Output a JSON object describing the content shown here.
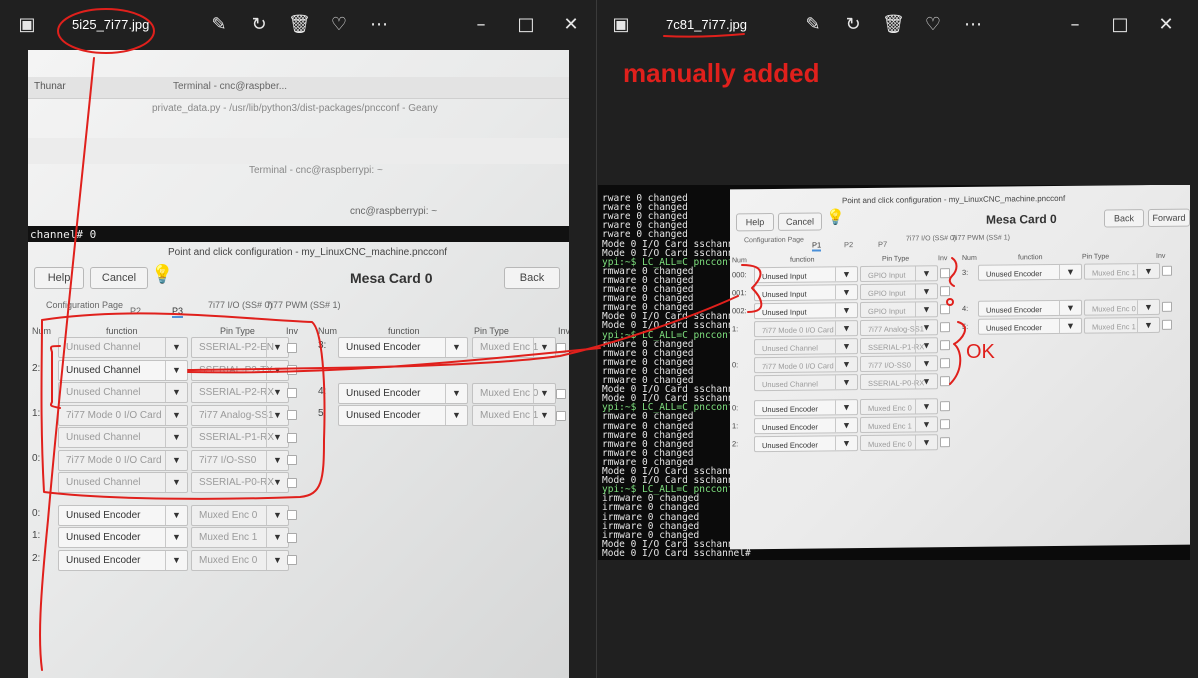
{
  "left_window": {
    "filename": "5i25_7i77.jpg",
    "icons": [
      "image-icon",
      "edit-icon",
      "rotate-icon",
      "delete-icon",
      "heart-icon",
      "more-icon",
      "minimize-icon",
      "maximize-icon",
      "close-icon"
    ],
    "photo": {
      "taskbar_thunar": "Thunar",
      "taskbar_terminal": "Terminal - cnc@raspber...",
      "geany_title": "private_data.py - /usr/lib/python3/dist-packages/pncconf - Geany",
      "terminal_title": "Terminal - cnc@raspberrypi: ~",
      "terminal_tab": "cnc@raspberrypi: ~",
      "terminal_line": "channel# 0",
      "dialog_title": "Point and click configuration - my_LinuxCNC_machine.pncconf",
      "help_btn": "Help",
      "cancel_btn": "Cancel",
      "back_btn": "Back",
      "heading": "Mesa Card 0",
      "tabs": [
        "Configuration Page",
        "P2",
        "P3",
        "7i77 I/O (SS# 0)",
        "7i77 PWM (SS# 1)"
      ],
      "col_headers": {
        "num": "Num",
        "function": "function",
        "pin_type": "Pin Type",
        "inv": "Inv",
        "num2": "Num",
        "function2": "function",
        "pin_type2": "Pin Type",
        "inv2": "Inv"
      },
      "rows_left": [
        {
          "num": "",
          "function": "Unused Channel",
          "pin": "SSERIAL-P2-EN",
          "dim": true
        },
        {
          "num": "2:",
          "function": "Unused Channel",
          "pin": "SSERIAL-P2-TX",
          "dim": false
        },
        {
          "num": "",
          "function": "Unused Channel",
          "pin": "SSERIAL-P2-RX",
          "dim": true
        },
        {
          "num": "1:",
          "function": "7i77 Mode 0 I/O Card",
          "pin": "7i77 Analog-SS1",
          "dim": true
        },
        {
          "num": "",
          "function": "Unused Channel",
          "pin": "SSERIAL-P1-RX",
          "dim": true
        },
        {
          "num": "0:",
          "function": "7i77 Mode 0 I/O Card",
          "pin": "7i77 I/O-SS0",
          "dim": true
        },
        {
          "num": "",
          "function": "Unused Channel",
          "pin": "SSERIAL-P0-RX",
          "dim": true
        },
        {
          "num": "0:",
          "function": "Unused Encoder",
          "pin": "Muxed Enc 0",
          "dim": false
        },
        {
          "num": "1:",
          "function": "Unused Encoder",
          "pin": "Muxed Enc 1",
          "dim": false
        },
        {
          "num": "2:",
          "function": "Unused Encoder",
          "pin": "Muxed Enc 0",
          "dim": false
        }
      ],
      "rows_right": [
        {
          "num": "3:",
          "function": "Unused Encoder",
          "pin": "Muxed Enc 1"
        },
        {
          "num": "4:",
          "function": "Unused Encoder",
          "pin": "Muxed Enc 0"
        },
        {
          "num": "5:",
          "function": "Unused Encoder",
          "pin": "Muxed Enc 1"
        }
      ]
    }
  },
  "right_window": {
    "filename": "7c81_7i77.jpg",
    "annotation_manual": "manually added",
    "annotation_ok": "OK",
    "photo": {
      "dialog_title": "Point and click configuration - my_LinuxCNC_machine.pncconf",
      "help_btn": "Help",
      "cancel_btn": "Cancel",
      "back_btn": "Back",
      "forward_btn": "Forward",
      "heading": "Mesa Card 0",
      "tabs": [
        "Configuration Page",
        "P1",
        "P2",
        "P7",
        "7i77 I/O (SS# 0)",
        "7i77 PWM (SS# 1)"
      ],
      "col_headers": {
        "num": "Num",
        "function": "function",
        "pin_type": "Pin Type",
        "inv": "Inv",
        "num2": "Num",
        "function2": "function",
        "pin_type2": "Pin Type",
        "inv2": "Inv"
      },
      "rows_left": [
        {
          "num": "000:",
          "function": "Unused Input",
          "pin": "GPIO Input",
          "dim": false
        },
        {
          "num": "001:",
          "function": "Unused Input",
          "pin": "GPIO Input",
          "dim": false
        },
        {
          "num": "002:",
          "function": "Unused Input",
          "pin": "GPIO Input",
          "dim": false
        },
        {
          "num": "1:",
          "function": "7i77 Mode 0 I/O Card",
          "pin": "7i77 Analog-SS1",
          "dim": true
        },
        {
          "num": "",
          "function": "Unused Channel",
          "pin": "SSERIAL-P1-RX",
          "dim": true
        },
        {
          "num": "0:",
          "function": "7i77 Mode 0 I/O Card",
          "pin": "7i77 I/O-SS0",
          "dim": true
        },
        {
          "num": "",
          "function": "Unused Channel",
          "pin": "SSERIAL-P0-RX",
          "dim": true
        },
        {
          "num": "0:",
          "function": "Unused Encoder",
          "pin": "Muxed Enc 0",
          "dim": false
        },
        {
          "num": "1:",
          "function": "Unused Encoder",
          "pin": "Muxed Enc 1",
          "dim": false
        },
        {
          "num": "2:",
          "function": "Unused Encoder",
          "pin": "Muxed Enc 0",
          "dim": false
        }
      ],
      "rows_right": [
        {
          "num": "3:",
          "function": "Unused Encoder",
          "pin": "Muxed Enc 1"
        },
        {
          "num": "4:",
          "function": "Unused Encoder",
          "pin": "Muxed Enc 0"
        },
        {
          "num": "5:",
          "function": "Unused Encoder",
          "pin": "Muxed Enc 1"
        }
      ],
      "terminal_lines": [
        "rware 0 changed",
        "rware 0 changed",
        "rware 0 changed",
        "rware 0 changed",
        "rware 0 changed",
        "Mode 0 I/O Card sschannel#",
        "Mode 0 I/O Card sschannel#",
        "ypi:~$ LC_ALL=C pncconf",
        "rmware 0 changed",
        "rmware 0 changed",
        "rmware 0 changed",
        "rmware 0 changed",
        "rmware 0 changed",
        "Mode 0 I/O Card sschannel#",
        "Mode 0 I/O Card sschannel#",
        "ypi:~$ LC_ALL=C pncconf",
        "rmware 0 changed",
        "rmware 0 changed",
        "rmware 0 changed",
        "rmware 0 changed",
        "rmware 0 changed",
        "Mode 0 I/O Card sschannel#",
        "Mode 0 I/O Card sschannel#",
        "ypi:~$ LC_ALL=C pncconf",
        "rmware 0 changed",
        "rmware 0 changed",
        "rmware 0 changed",
        "rmware 0 changed",
        "rmware 0 changed",
        "rmware 0 changed",
        "Mode 0 I/O Card sschannel#",
        "Mode 0 I/O Card sschannel#",
        "ypi:~$ LC_ALL=C pncconf",
        "irmware 0 changed",
        "irmware 0 changed",
        "irmware 0 changed",
        "irmware 0 changed",
        "irmware 0 changed",
        "Mode 0 I/O Card sschannel#",
        "Mode 0 I/O Card sschannel#"
      ]
    }
  }
}
